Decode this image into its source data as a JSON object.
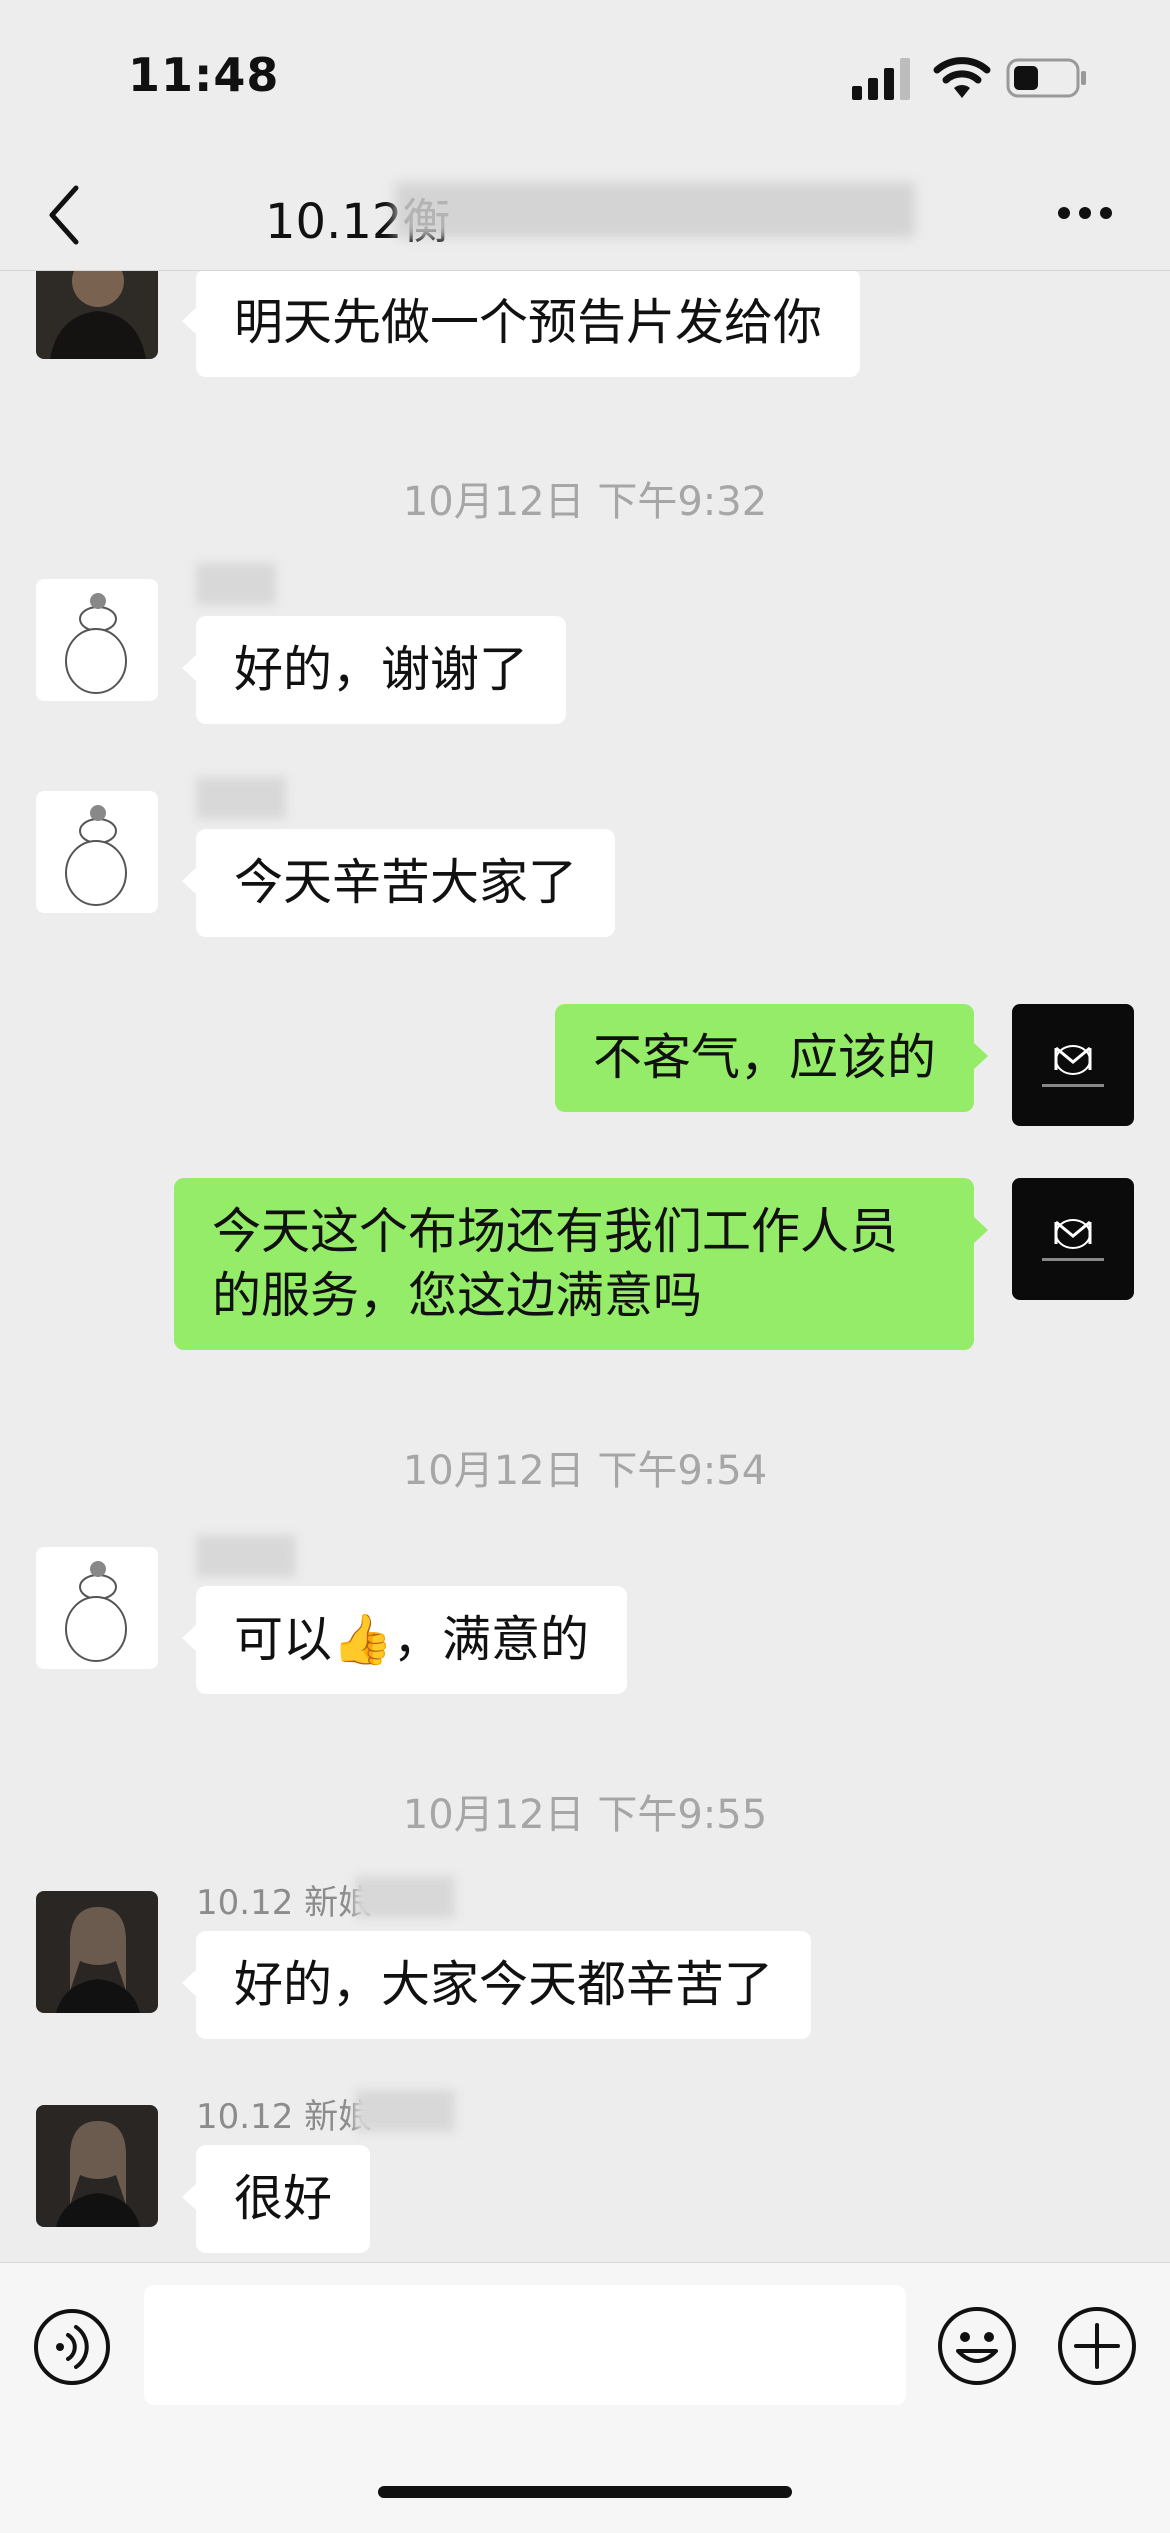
{
  "status_bar": {
    "time": "11:48"
  },
  "nav": {
    "title": "10.12衡"
  },
  "messages": {
    "m1": {
      "text": "明天先做一个预告片发给你"
    },
    "ts1": "10月12日 下午9:32",
    "m2": {
      "text": "好的，谢谢了"
    },
    "m3": {
      "text": "今天辛苦大家了"
    },
    "m4": {
      "text": "不客气，应该的"
    },
    "m5": {
      "text": "今天这个布场还有我们工作人员的服务，您这边满意吗"
    },
    "ts2": "10月12日 下午9:54",
    "m6": {
      "text_before": "可以",
      "emoji": "👍",
      "text_after": "，满意的"
    },
    "ts3": "10月12日 下午9:55",
    "m7": {
      "sender": "10.12 新娘",
      "text": "好的，大家今天都辛苦了"
    },
    "m8": {
      "sender": "10.12 新娘",
      "text": "很好"
    }
  },
  "input": {
    "placeholder": ""
  },
  "colors": {
    "background": "#EDEDED",
    "incoming_bubble": "#FFFFFF",
    "outgoing_bubble": "#95EC69",
    "timestamp": "#A6A6A6"
  },
  "icons": {
    "back": "chevron-left-icon",
    "more": "more-dots-icon",
    "voice": "voice-icon",
    "emoji": "emoji-icon",
    "plus": "plus-icon"
  }
}
